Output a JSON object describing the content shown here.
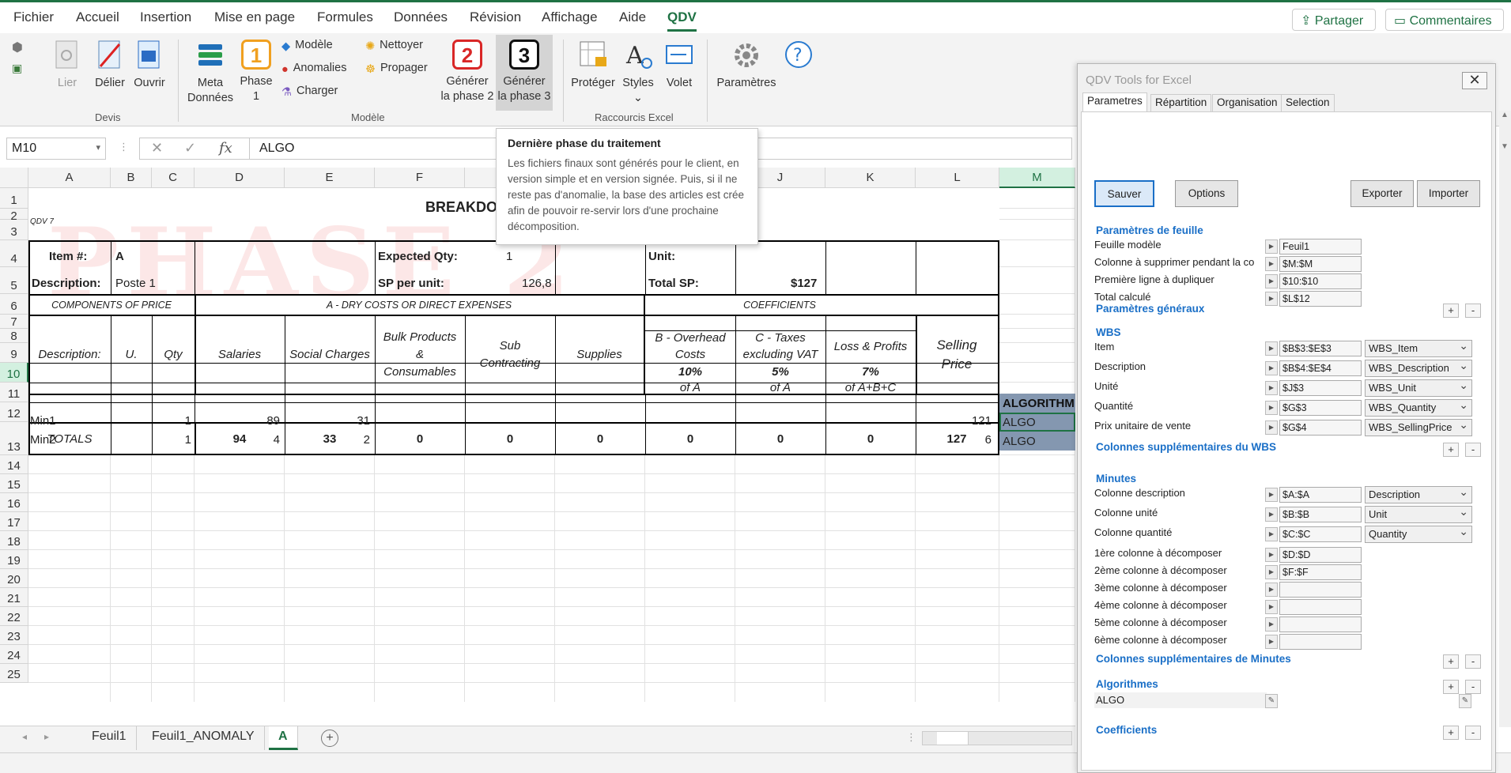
{
  "menu": {
    "items": [
      "Fichier",
      "Accueil",
      "Insertion",
      "Mise en page",
      "Formules",
      "Données",
      "Révision",
      "Affichage",
      "Aide",
      "QDV"
    ],
    "active": "QDV",
    "share_label": "Partager",
    "comments_label": "Commentaires"
  },
  "ribbon": {
    "lier": "Lier",
    "delier": "Délier",
    "ouvrir": "Ouvrir",
    "group_devis": "Devis",
    "meta_line1": "Meta",
    "meta_line2": "Données",
    "phase1_num": "1",
    "phase1_line1": "Phase",
    "phase1_line2": "1",
    "modele": "Modèle",
    "anomalies": "Anomalies",
    "charger": "Charger",
    "nettoyer": "Nettoyer",
    "propager": "Propager",
    "phase2_num": "2",
    "phase2_line1": "Générer",
    "phase2_line2": "la phase 2",
    "phase3_num": "3",
    "phase3_line1": "Générer",
    "phase3_line2": "la phase 3",
    "group_modele": "Modèle",
    "proteger": "Protéger",
    "styles": "Styles",
    "volet": "Volet",
    "group_raccourcis": "Raccourcis Excel",
    "parametres": "Paramètres"
  },
  "formula_bar": {
    "name_box": "M10",
    "fx": "fx",
    "value": "ALGO"
  },
  "tooltip": {
    "title": "Dernière phase du traitement",
    "text": "Les fichiers finaux sont générés pour le client, en version simple et en version signée. Puis, si il ne reste pas d'anomalie, la base des articles est crée afin de pouvoir re-servir lors d'une prochaine décomposition."
  },
  "grid": {
    "columns": [
      "A",
      "B",
      "C",
      "D",
      "E",
      "F",
      "G",
      "H",
      "I",
      "J",
      "K",
      "L",
      "M"
    ],
    "rows": [
      "1",
      "2",
      "3",
      "4",
      "5",
      "6",
      "7",
      "8",
      "9",
      "10",
      "11",
      "12",
      "13",
      "14",
      "15",
      "16",
      "17",
      "18",
      "19",
      "20",
      "21",
      "22",
      "23",
      "24",
      "25"
    ],
    "watermark": "PHASE 2",
    "title": "BREAKDO",
    "qdv": "QDV 7",
    "item_label": "Item #:",
    "item_value": "A",
    "expected_label": "Expected Qty:",
    "expected_value": "1",
    "unit_label": "Unit:",
    "desc_label": "Description:",
    "desc_value": "Poste 1",
    "sp_label": "SP per unit:",
    "sp_value": "126,8",
    "total_sp_label": "Total SP:",
    "total_sp_value": "$127",
    "components": "COMPONENTS OF PRICE",
    "dry_costs": "A - DRY COSTS OR DIRECT EXPENSES",
    "coefficients": "COEFFICIENTS",
    "h_description": "Description:",
    "h_u": "U.",
    "h_qty": "Qty",
    "h_salaries": "Salaries",
    "h_social": "Social Charges",
    "h_bulk": "Bulk Products & Consumables",
    "h_sub": "Sub Contracting",
    "h_supplies": "Supplies",
    "h_overhead": "B - Overhead Costs",
    "h_overhead_pct": "10%",
    "h_overhead_of": "of A",
    "h_taxes": "C - Taxes excluding VAT",
    "h_taxes_pct": "5%",
    "h_taxes_of": "of A",
    "h_loss": "Loss & Profits",
    "h_loss_pct": "7%",
    "h_loss_of": "of A+B+C",
    "h_selling": "Selling Price",
    "algorithm": "ALGORITHM",
    "rows_data": [
      {
        "desc": "Min1",
        "qty": "1",
        "salaries": "89",
        "social": "31",
        "selling": "121",
        "algo": "ALGO"
      },
      {
        "desc": "Min2",
        "qty": "1",
        "salaries": "4",
        "social": "2",
        "selling": "6",
        "algo": "ALGO"
      }
    ],
    "totals_label": "TOTALS",
    "totals": [
      "94",
      "33",
      "0",
      "0",
      "0",
      "0",
      "0",
      "0",
      "127"
    ]
  },
  "tabs": {
    "sheets": [
      "Feuil1",
      "Feuil1_ANOMALY",
      "A"
    ],
    "active": "A"
  },
  "panel": {
    "title": "QDV Tools for Excel",
    "close": "✕",
    "tabs": [
      "Parametres",
      "Répartition",
      "Organisation",
      "Selection"
    ],
    "btn_save": "Sauver",
    "btn_options": "Options",
    "btn_export": "Exporter",
    "btn_import": "Importer",
    "sec_feuille": "Paramètres de feuille",
    "feuille_rows": [
      {
        "label": "Feuille modèle",
        "value": "Feuil1"
      },
      {
        "label": "Colonne à supprimer pendant la co",
        "value": "$M:$M"
      },
      {
        "label": "Première ligne à dupliquer",
        "value": "$10:$10"
      },
      {
        "label": "Total calculé",
        "value": "$L$12"
      }
    ],
    "sec_generaux": "Paramètres généraux",
    "sec_wbs": "WBS",
    "wbs_rows": [
      {
        "label": "Item",
        "value": "$B$3:$E$3",
        "select": "WBS_Item"
      },
      {
        "label": "Description",
        "value": "$B$4:$E$4",
        "select": "WBS_Description"
      },
      {
        "label": "Unité",
        "value": "$J$3",
        "select": "WBS_Unit"
      },
      {
        "label": "Quantité",
        "value": "$G$3",
        "select": "WBS_Quantity"
      },
      {
        "label": "Prix unitaire de vente",
        "value": "$G$4",
        "select": "WBS_SellingPrice"
      }
    ],
    "sec_wbs_extra": "Colonnes supplémentaires du WBS",
    "sec_minutes": "Minutes",
    "minutes_rows": [
      {
        "label": "Colonne description",
        "value": "$A:$A",
        "select": "Description"
      },
      {
        "label": "Colonne unité",
        "value": "$B:$B",
        "select": "Unit"
      },
      {
        "label": "Colonne quantité",
        "value": "$C:$C",
        "select": "Quantity"
      }
    ],
    "decompose_rows": [
      {
        "label": "1ère colonne à décomposer",
        "value": "$D:$D"
      },
      {
        "label": "2ème colonne à décomposer",
        "value": "$F:$F"
      },
      {
        "label": "3ème colonne à décomposer",
        "value": ""
      },
      {
        "label": "4ème colonne à décomposer",
        "value": ""
      },
      {
        "label": "5ème colonne à décomposer",
        "value": ""
      },
      {
        "label": "6ème colonne à décomposer",
        "value": ""
      }
    ],
    "sec_minutes_extra": "Colonnes supplémentaires de Minutes",
    "sec_algos": "Algorithmes",
    "algo_value": "ALGO",
    "sec_coefs": "Coefficients",
    "plus": "+",
    "minus": "-"
  },
  "colors": {
    "accent": "#1f7244",
    "panel_blue": "#1a6fc7",
    "algo_fill": "#8497b0"
  }
}
